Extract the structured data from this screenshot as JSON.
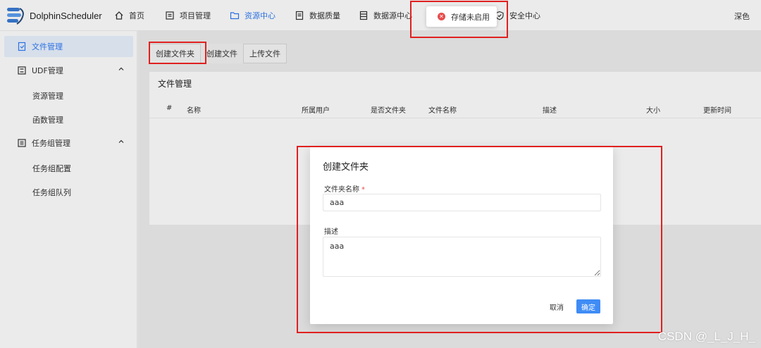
{
  "app": {
    "name": "DolphinScheduler"
  },
  "nav": [
    {
      "label": "首页",
      "icon": "home-icon"
    },
    {
      "label": "项目管理",
      "icon": "project-icon"
    },
    {
      "label": "资源中心",
      "icon": "folder-icon",
      "active": true
    },
    {
      "label": "数据质量",
      "icon": "quality-icon"
    },
    {
      "label": "数据源中心",
      "icon": "datasource-icon"
    },
    {
      "label": "安全中心",
      "icon": "shield-icon"
    }
  ],
  "theme_label": "深色",
  "sidebar": {
    "items": [
      {
        "label": "文件管理",
        "icon": "file-icon",
        "active": true
      },
      {
        "label": "UDF管理",
        "icon": "udf-icon",
        "expanded": true
      },
      {
        "label": "资源管理"
      },
      {
        "label": "函数管理"
      },
      {
        "label": "任务组管理",
        "icon": "taskgroup-icon",
        "expanded": true
      },
      {
        "label": "任务组配置"
      },
      {
        "label": "任务组队列"
      }
    ]
  },
  "toolbar": {
    "create_folder": "创建文件夹",
    "create_file": "创建文件",
    "upload_file": "上传文件"
  },
  "card": {
    "title": "文件管理",
    "columns": [
      "#",
      "名称",
      "所属用户",
      "是否文件夹",
      "文件名称",
      "描述",
      "大小",
      "更新时间"
    ]
  },
  "toast": {
    "message": "存储未启用",
    "icon": "error-icon"
  },
  "modal": {
    "title": "创建文件夹",
    "name_label": "文件夹名称",
    "required_mark": "*",
    "name_value": "aaa",
    "desc_label": "描述",
    "desc_value": "aaa",
    "cancel": "取消",
    "confirm": "确定"
  },
  "watermark": "CSDN @_L_J_H_"
}
